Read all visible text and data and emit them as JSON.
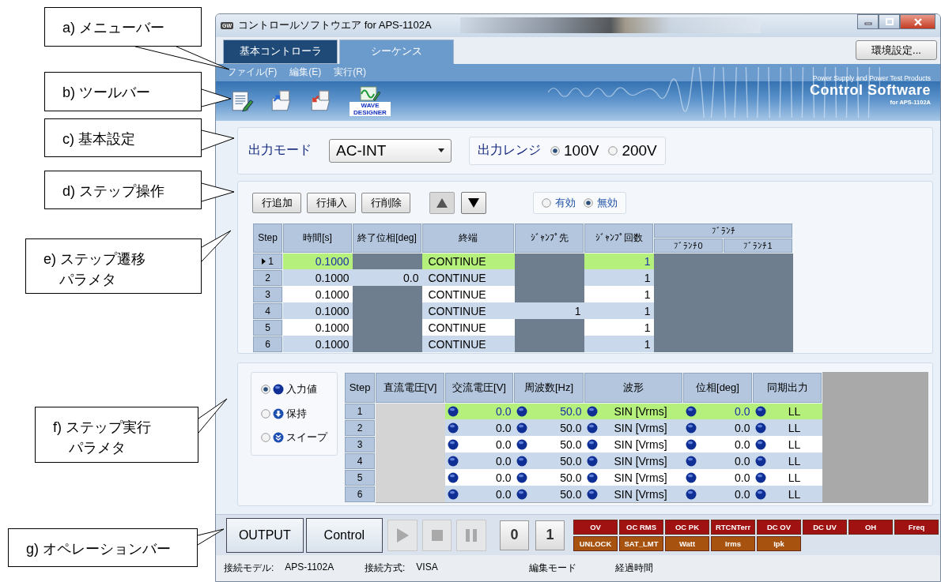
{
  "annotations": [
    {
      "text": "a) メニューバー"
    },
    {
      "text": "b) ツールバー"
    },
    {
      "text": "c) 基本設定"
    },
    {
      "text": "d) ステップ操作"
    },
    {
      "text": "e) ステップ遷移",
      "text_2": "パラメタ"
    },
    {
      "text": "f) ステップ実行",
      "text_2": "パラメタ"
    },
    {
      "text": "g) オペレーションバー"
    }
  ],
  "window": {
    "logo": "GW",
    "title": "コントロールソフトウエア for APS-1102A"
  },
  "tabs": [
    {
      "label": "基本コントローラ",
      "selected": false
    },
    {
      "label": "シーケンス",
      "selected": true
    }
  ],
  "settings_button": "環境設定...",
  "menu": [
    "ファイル(F)",
    "編集(E)",
    "実行(R)"
  ],
  "toolbar": [
    {
      "kind": "document"
    },
    {
      "kind": "folder_in"
    },
    {
      "kind": "folder_out"
    },
    {
      "kind": "wave",
      "label": "WAVE DESIGNER"
    }
  ],
  "brand": {
    "tagline": "Power Supply and Power Test Products",
    "name": "Control Software",
    "model": "for APS-1102A"
  },
  "basic_settings": {
    "mode_label": "出力モード",
    "mode_value": "AC-INT",
    "range_label": "出力レンジ",
    "ranges": [
      {
        "label": "100V",
        "selected": true
      },
      {
        "label": "200V",
        "selected": false
      }
    ]
  },
  "step_operations": {
    "buttons": [
      "行追加",
      "行挿入",
      "行削除"
    ],
    "arrows": [
      {
        "kind": "up",
        "disabled": true
      },
      {
        "kind": "down",
        "disabled": false
      }
    ],
    "enable_options": [
      {
        "label": "有効",
        "selected": false
      },
      {
        "label": "無効",
        "selected": true
      }
    ]
  },
  "transition_table": {
    "columns": [
      "Step",
      "時間[s]",
      "終了位相[deg]",
      "終端",
      "ｼﾞｬﾝﾌﾟ先",
      "ｼﾞｬﾝﾌﾟ回数"
    ],
    "branch_group": "ﾌﾞﾗﾝﾁ",
    "branch_columns": [
      "ﾌﾞﾗﾝﾁ0",
      "ﾌﾞﾗﾝﾁ1"
    ],
    "rows": [
      {
        "step": "1",
        "current": true,
        "selected": true,
        "time": "0.1000",
        "end": "CONTINUE",
        "jump_count": "1"
      },
      {
        "step": "2",
        "current": false,
        "selected": false,
        "time": "0.1000",
        "end_phase": "0.0",
        "end": "CONTINUE",
        "jump_count": "1"
      },
      {
        "step": "3",
        "current": false,
        "selected": false,
        "time": "0.1000",
        "end": "CONTINUE",
        "jump_count": "1"
      },
      {
        "step": "4",
        "current": false,
        "selected": false,
        "time": "0.1000",
        "end": "CONTINUE",
        "jump_to": "1",
        "jump_count": "1"
      },
      {
        "step": "5",
        "current": false,
        "selected": false,
        "time": "0.1000",
        "end": "CONTINUE",
        "jump_count": "1"
      },
      {
        "step": "6",
        "current": false,
        "selected": false,
        "time": "0.1000",
        "end": "CONTINUE",
        "jump_count": "1"
      }
    ]
  },
  "execution": {
    "modes": [
      {
        "kind": "input",
        "label": "入力値",
        "selected": true
      },
      {
        "kind": "hold",
        "label": "保持",
        "selected": false
      },
      {
        "kind": "sweep",
        "label": "スイープ",
        "selected": false
      }
    ],
    "columns": [
      "Step",
      "直流電圧[V]",
      "交流電圧[V]",
      "周波数[Hz]",
      "波形",
      "位相[deg]",
      "同期出力"
    ],
    "rows": [
      {
        "step": "1",
        "selected": true,
        "ac": "0.0",
        "freq": "50.0",
        "wave": "SIN [Vrms]",
        "phase": "0.0",
        "sync": "LL"
      },
      {
        "step": "2",
        "selected": false,
        "ac": "0.0",
        "freq": "50.0",
        "wave": "SIN [Vrms]",
        "phase": "0.0",
        "sync": "LL"
      },
      {
        "step": "3",
        "selected": false,
        "ac": "0.0",
        "freq": "50.0",
        "wave": "SIN [Vrms]",
        "phase": "0.0",
        "sync": "LL"
      },
      {
        "step": "4",
        "selected": false,
        "ac": "0.0",
        "freq": "50.0",
        "wave": "SIN [Vrms]",
        "phase": "0.0",
        "sync": "LL"
      },
      {
        "step": "5",
        "selected": false,
        "ac": "0.0",
        "freq": "50.0",
        "wave": "SIN [Vrms]",
        "phase": "0.0",
        "sync": "LL"
      },
      {
        "step": "6",
        "selected": false,
        "ac": "0.0",
        "freq": "50.0",
        "wave": "SIN [Vrms]",
        "phase": "0.0",
        "sync": "LL"
      }
    ]
  },
  "operation": {
    "output": "OUTPUT",
    "control": "Control",
    "transport": [
      {
        "kind": "play",
        "disabled": true
      },
      {
        "kind": "stop",
        "disabled": true
      },
      {
        "kind": "pause",
        "disabled": true
      }
    ],
    "memory": [
      "0",
      "1"
    ],
    "alarms": [
      {
        "label": "OV",
        "color": "#a01212"
      },
      {
        "label": "OC RMS",
        "color": "#a01212"
      },
      {
        "label": "OC PK",
        "color": "#a01212"
      },
      {
        "label": "RTCNTerr",
        "color": "#a01212"
      },
      {
        "label": "DC OV",
        "color": "#a01212"
      },
      {
        "label": "DC UV",
        "color": "#a01212"
      },
      {
        "label": "OH",
        "color": "#a01212"
      },
      {
        "label": "Freq",
        "color": "#a01212"
      },
      {
        "label": "UNLOCK",
        "color": "#a8520f"
      },
      {
        "label": "SAT_LMT",
        "color": "#a8520f"
      },
      {
        "label": "Watt",
        "color": "#a8520f"
      },
      {
        "label": "Irms",
        "color": "#a8520f"
      },
      {
        "label": "Ipk",
        "color": "#a8520f"
      }
    ]
  },
  "status_bar": [
    {
      "label": "接続モデル:",
      "value": "APS-1102A"
    },
    {
      "label": "接続方式:",
      "value": "VISA"
    },
    {
      "label": "編集モード"
    },
    {
      "label": "経過時間"
    }
  ]
}
